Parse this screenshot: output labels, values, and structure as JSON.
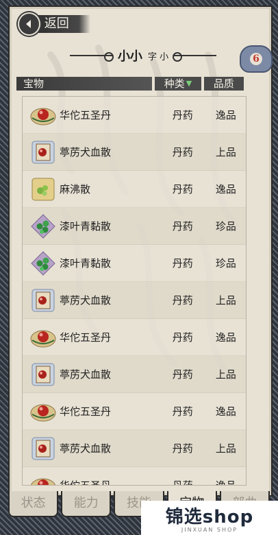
{
  "header": {
    "back_label": "返回",
    "title_main": "小小",
    "title_sub": "字 小",
    "count": "6"
  },
  "columns": {
    "name": "宝物",
    "type": "种类",
    "quality": "品质"
  },
  "items": [
    {
      "name": "华佗五圣丹",
      "type": "丹药",
      "quality": "逸品",
      "icon": "pill-red-icon"
    },
    {
      "name": "葶苈犬血散",
      "type": "丹药",
      "quality": "上品",
      "icon": "scroll-red-icon"
    },
    {
      "name": "麻沸散",
      "type": "丹药",
      "quality": "逸品",
      "icon": "herb-green-icon"
    },
    {
      "name": "漆叶青黏散",
      "type": "丹药",
      "quality": "珍品",
      "icon": "beads-green-icon"
    },
    {
      "name": "漆叶青黏散",
      "type": "丹药",
      "quality": "珍品",
      "icon": "beads-green-icon"
    },
    {
      "name": "葶苈犬血散",
      "type": "丹药",
      "quality": "上品",
      "icon": "scroll-red-icon"
    },
    {
      "name": "华佗五圣丹",
      "type": "丹药",
      "quality": "逸品",
      "icon": "pill-red-icon"
    },
    {
      "name": "葶苈犬血散",
      "type": "丹药",
      "quality": "上品",
      "icon": "scroll-red-icon"
    },
    {
      "name": "华佗五圣丹",
      "type": "丹药",
      "quality": "逸品",
      "icon": "pill-red-icon"
    },
    {
      "name": "葶苈犬血散",
      "type": "丹药",
      "quality": "上品",
      "icon": "scroll-red-icon"
    },
    {
      "name": "华佗五圣丹",
      "type": "丹药",
      "quality": "逸品",
      "icon": "pill-red-icon"
    }
  ],
  "tabs": [
    {
      "label": "状态",
      "active": false
    },
    {
      "label": "能力",
      "active": false
    },
    {
      "label": "技能",
      "active": false
    },
    {
      "label": "宝物",
      "active": true
    },
    {
      "label": "部曲",
      "active": false
    }
  ],
  "watermark": {
    "main": "锦选shop",
    "sub": "JINXUAN SHOP"
  }
}
